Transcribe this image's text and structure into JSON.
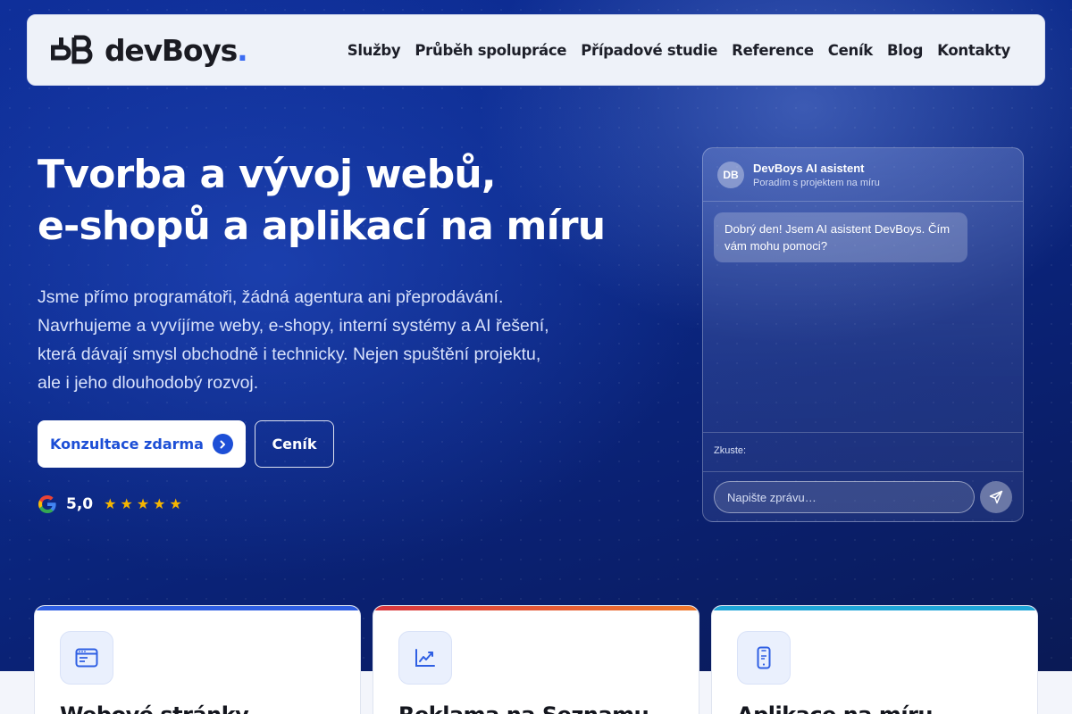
{
  "nav": {
    "logo_text": "devBoys",
    "logo_dot": ".",
    "links": [
      "Služby",
      "Průběh spolupráce",
      "Případové studie",
      "Reference",
      "Ceník",
      "Blog",
      "Kontakty"
    ]
  },
  "hero": {
    "title_lines": [
      "Tvorba a vývoj webů,",
      "e-shopů a aplikací na míru"
    ],
    "description_lines": [
      "Jsme přímo programátoři, žádná agentura ani přeprodávání.",
      "Navrhujeme a vyvíjíme weby, e-shopy, interní systémy a AI řešení,",
      "která dávají smysl obchodně i technicky. Nejen spuštění projektu,",
      "ale i jeho dlouhodobý rozvoj."
    ],
    "primary_button": "Konzultace zdarma",
    "secondary_button": "Ceník",
    "rating": {
      "score": "5,0",
      "stars": 5,
      "star_glyph": "★"
    }
  },
  "chat": {
    "avatar": "DB",
    "name": "DevBoys AI asistent",
    "subtitle": "Poradím s projektem na míru",
    "messages": [
      "Dobrý den! Jsem AI asistent DevBoys. Čím vám mohu pomoci?"
    ],
    "suggestions_label": "Zkuste:",
    "input_placeholder": "Napište zprávu…"
  },
  "cards": [
    {
      "title": "Webové stránky",
      "icon": "browser-icon",
      "accent": "#2f5fe3"
    },
    {
      "title": "Reklama na Seznamu",
      "icon": "chart-line-icon",
      "accent": "#e8503a"
    },
    {
      "title": "Aplikace na míru",
      "icon": "mobile-phone-icon",
      "accent": "#1fa6d8"
    }
  ],
  "colors": {
    "hero_bg": "#0b2a8c",
    "brand_blue": "#1d4fd6",
    "star": "#f5b500"
  }
}
